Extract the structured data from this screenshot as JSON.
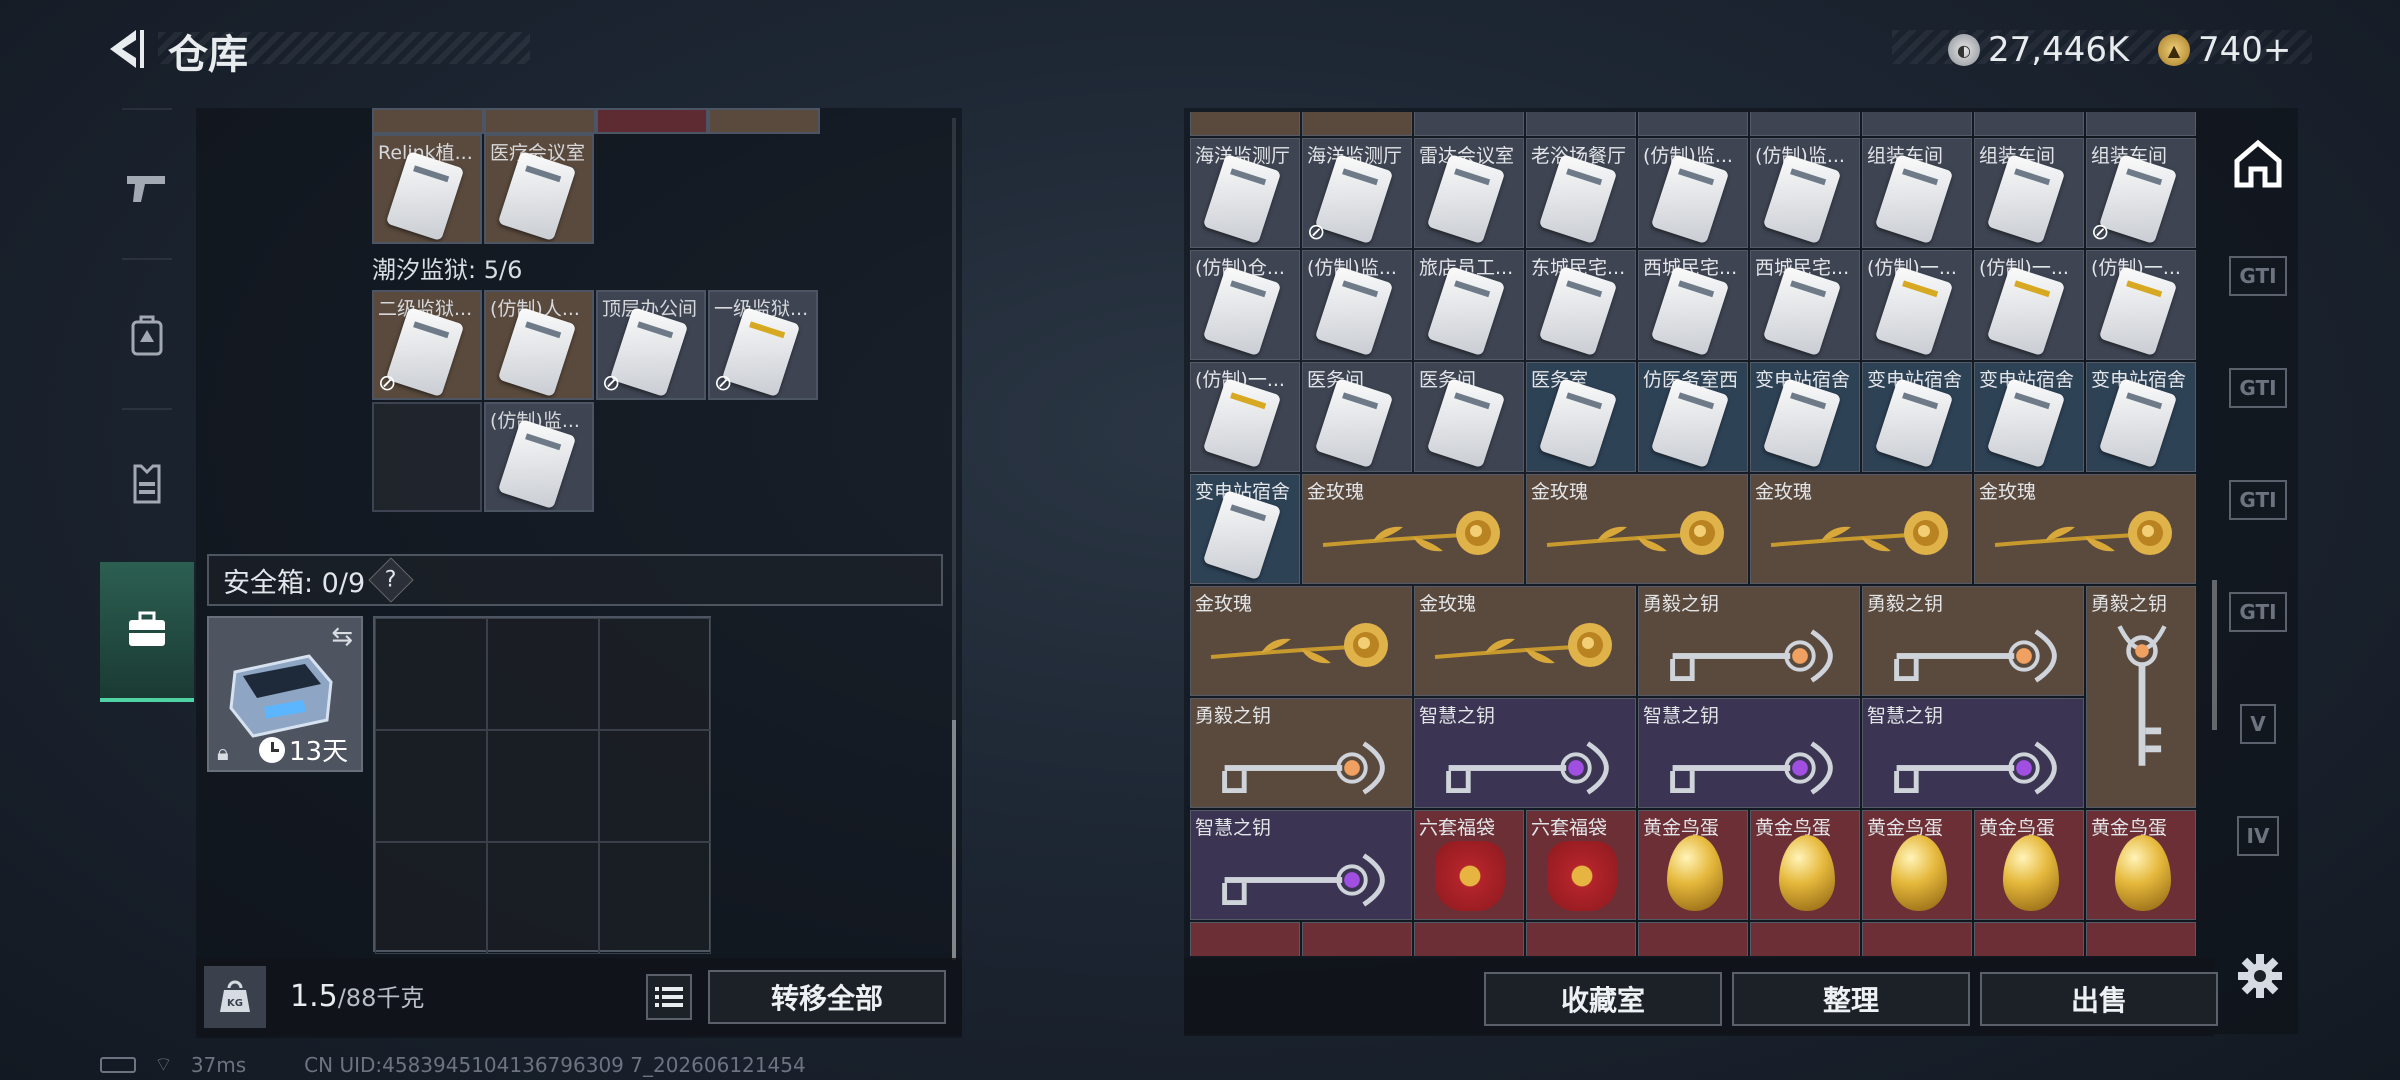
{
  "header": {
    "title": "仓库"
  },
  "currency": {
    "silver": "27,446K",
    "tokens": "740+"
  },
  "left_nav": [
    {
      "icon": "pistol-icon"
    },
    {
      "icon": "backpack-icon"
    },
    {
      "icon": "vest-icon"
    },
    {
      "icon": "briefcase-icon",
      "active": true
    }
  ],
  "left": {
    "top_cards": [
      {
        "label": "Relink植...",
        "color": "brown"
      },
      {
        "label": "医疗会议室",
        "color": "brown"
      }
    ],
    "section": "潮汐监狱: 5/6",
    "cards": [
      {
        "label": "二级监狱...",
        "color": "brown",
        "locked": true
      },
      {
        "label": "(仿制)人...",
        "color": "brown",
        "locked": false
      },
      {
        "label": "顶层办公间",
        "color": "gray",
        "locked": true
      },
      {
        "label": "一级监狱...",
        "color": "gray",
        "locked": true,
        "yellow": true
      },
      {
        "label": "(仿制)监...",
        "color": "gray",
        "locked": false
      }
    ],
    "safe_label": "安全箱: 0/9",
    "safe_help": "?",
    "safe_timer": "13天",
    "weight_current": "1.5",
    "weight_max": "/88千克",
    "transfer_button": "转移全部"
  },
  "right": {
    "rows": [
      [
        {
          "label": "海洋监测厅",
          "c": "gray"
        },
        {
          "label": "海洋监测厅",
          "c": "gray",
          "locked": true
        },
        {
          "label": "雷达会议室",
          "c": "gray"
        },
        {
          "label": "老浴场餐厅",
          "c": "gray"
        },
        {
          "label": "(仿制)监...",
          "c": "gray"
        },
        {
          "label": "(仿制)监...",
          "c": "gray"
        },
        {
          "label": "组装车间",
          "c": "gray"
        },
        {
          "label": "组装车间",
          "c": "gray"
        },
        {
          "label": "组装车间",
          "c": "gray",
          "locked": true
        }
      ],
      [
        {
          "label": "(仿制)仓...",
          "c": "gray"
        },
        {
          "label": "(仿制)监...",
          "c": "gray"
        },
        {
          "label": "旅店员工...",
          "c": "gray"
        },
        {
          "label": "东城民宅...",
          "c": "gray"
        },
        {
          "label": "西城民宅...",
          "c": "gray"
        },
        {
          "label": "西城民宅...",
          "c": "gray"
        },
        {
          "label": "(仿制)一...",
          "c": "gray",
          "yellow": true
        },
        {
          "label": "(仿制)一...",
          "c": "gray",
          "yellow": true
        },
        {
          "label": "(仿制)一...",
          "c": "gray",
          "yellow": true
        }
      ],
      [
        {
          "label": "(仿制)一...",
          "c": "gray",
          "yellow": true
        },
        {
          "label": "医务间",
          "c": "gray"
        },
        {
          "label": "医务间",
          "c": "gray"
        },
        {
          "label": "医务室",
          "c": "blue"
        },
        {
          "label": "仿医务室西",
          "c": "blue"
        },
        {
          "label": "变电站宿舍",
          "c": "blue"
        },
        {
          "label": "变电站宿舍",
          "c": "blue"
        },
        {
          "label": "变电站宿舍",
          "c": "blue"
        },
        {
          "label": "变电站宿舍",
          "c": "blue"
        }
      ]
    ],
    "row4": {
      "card": "变电站宿舍",
      "roses": [
        "金玫瑰",
        "金玫瑰",
        "金玫瑰",
        "金玫瑰"
      ]
    },
    "row5": {
      "roses": [
        "金玫瑰",
        "金玫瑰"
      ],
      "keys": [
        "勇毅之钥",
        "勇毅之钥"
      ],
      "tall_key": "勇毅之钥"
    },
    "row6": {
      "keys": [
        "勇毅之钥",
        "智慧之钥",
        "智慧之钥",
        "智慧之钥"
      ]
    },
    "row7": {
      "key": "智慧之钥",
      "bags": [
        "六套福袋",
        "六套福袋"
      ],
      "eggs": [
        "黄金鸟蛋",
        "黄金鸟蛋",
        "黄金鸟蛋",
        "黄金鸟蛋",
        "黄金鸟蛋"
      ]
    },
    "buttons": {
      "collection": "收藏室",
      "organize": "整理",
      "sell": "出售"
    }
  },
  "right_nav": [
    "home-icon",
    "GTI",
    "GTI",
    "GTI",
    "GTI",
    "V",
    "IV"
  ],
  "status": {
    "ping": "37ms",
    "uid": "CN UID:4583945104136796309 7_202606121454"
  },
  "colors": {
    "brown": "#5a4a3d",
    "gray": "#3e4452",
    "blue": "#2e4256",
    "gold": "#d8a93a",
    "red": "#6b2f35",
    "purple": "#3b3553"
  }
}
